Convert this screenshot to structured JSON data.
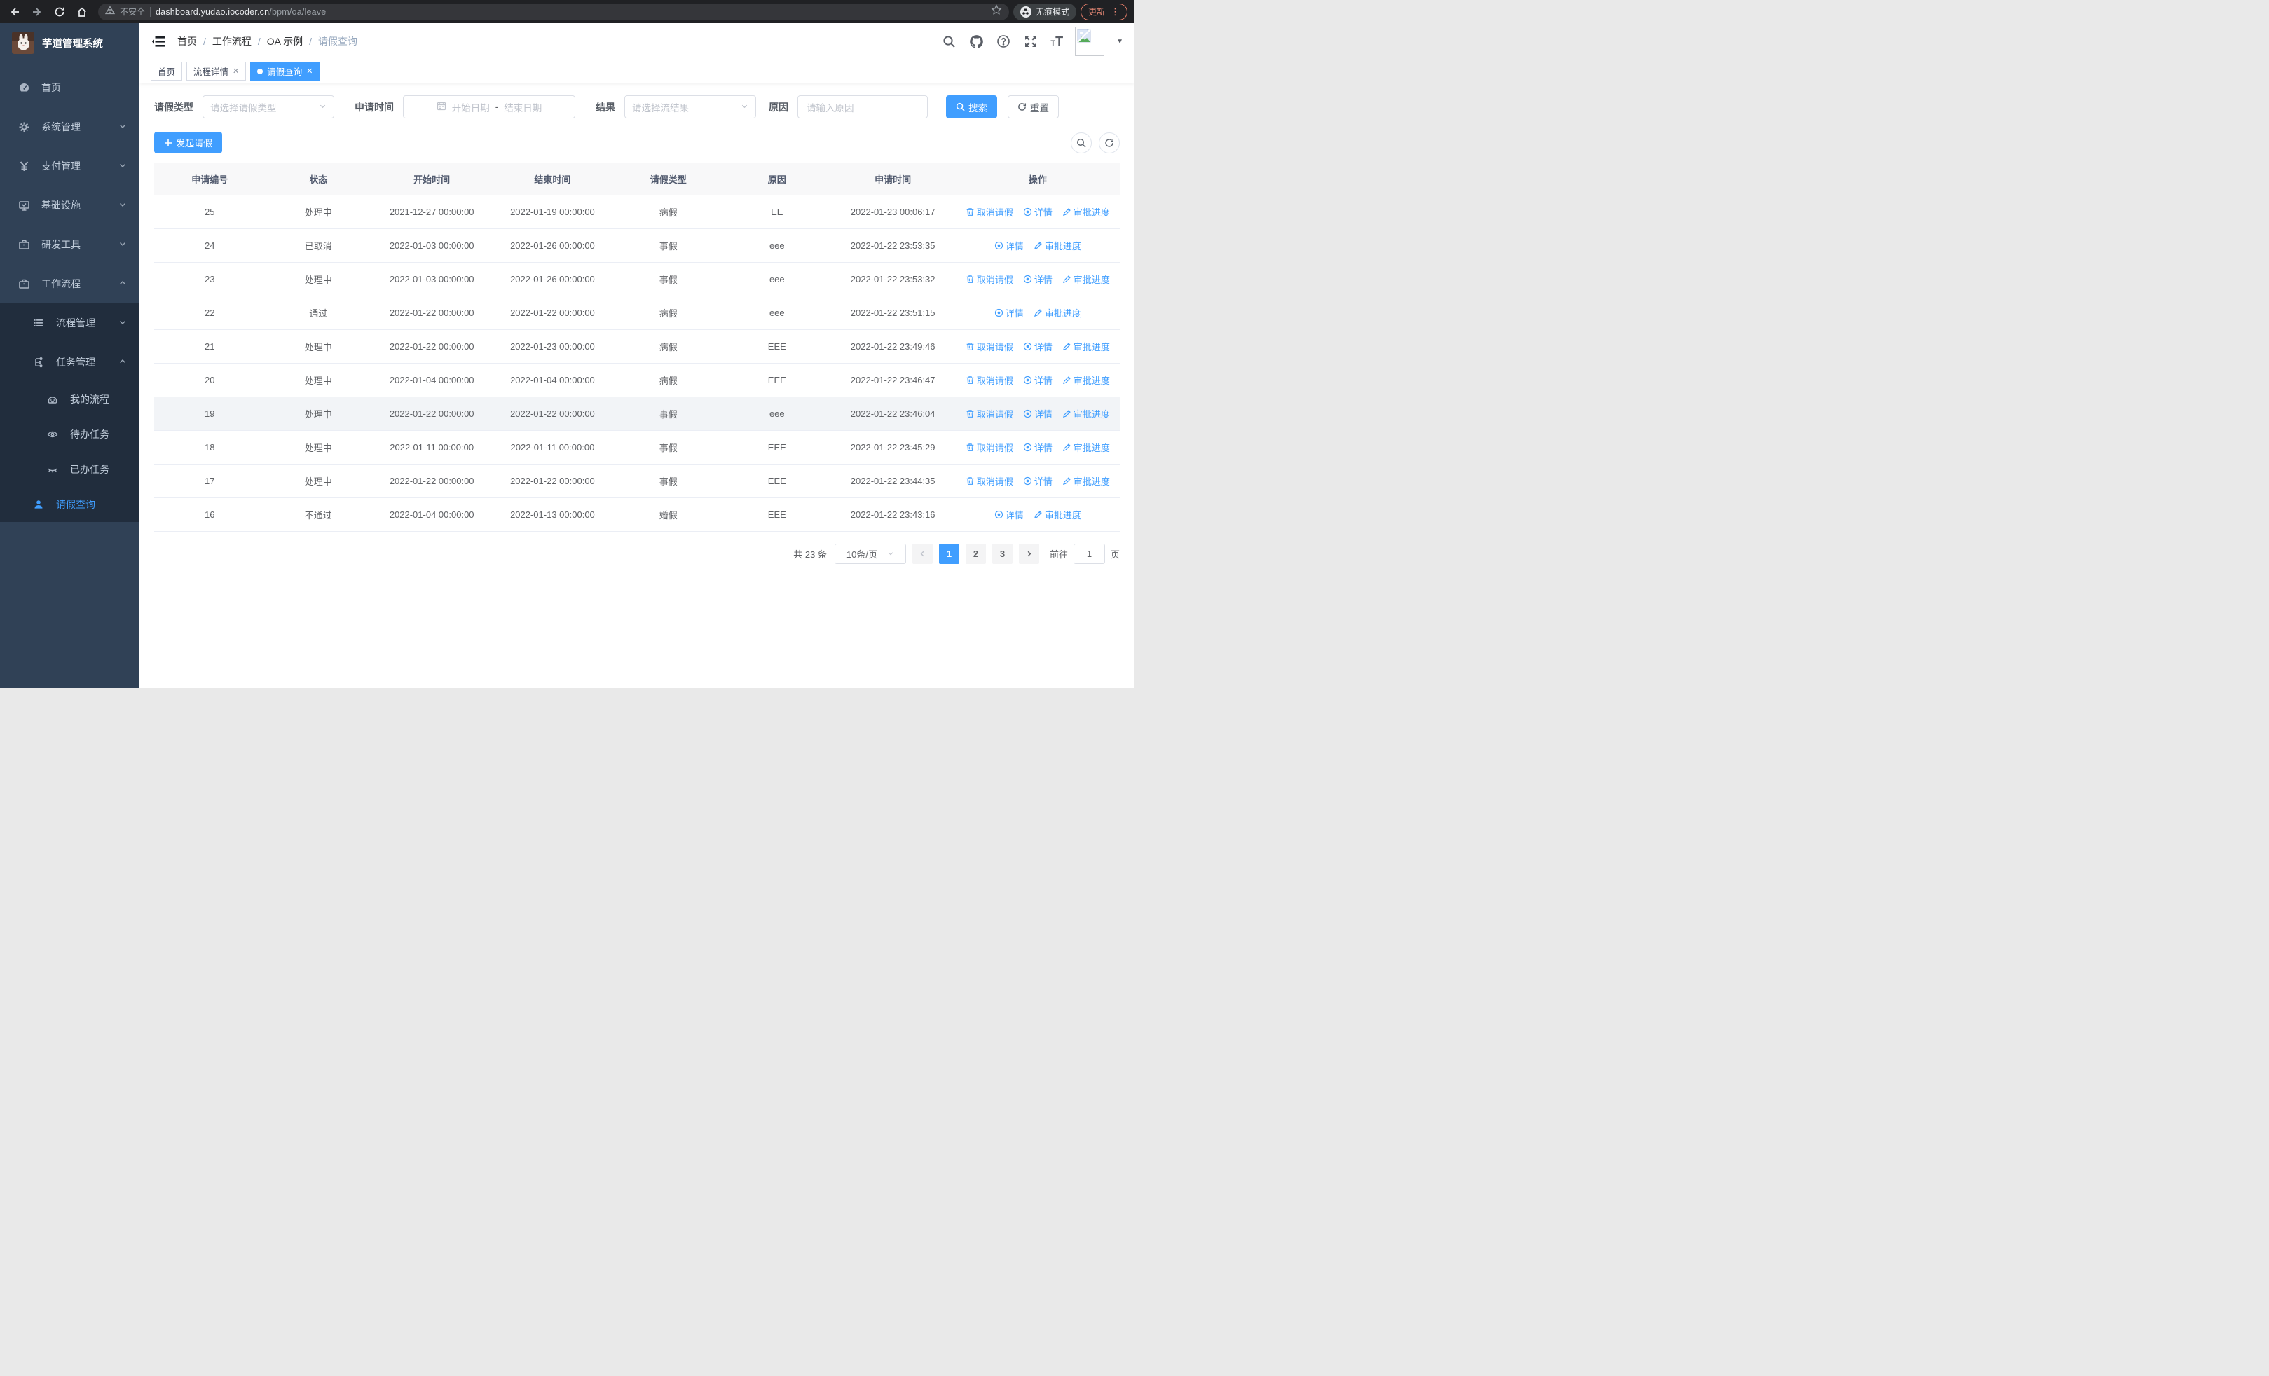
{
  "colors": {
    "primary": "#409EFF",
    "sidebar_bg": "#304156",
    "submenu_bg": "#212d3d",
    "chrome_bg": "#202124",
    "update_accent": "#E07B67",
    "table_header_bg": "#F8F8F9"
  },
  "browser": {
    "security_label": "不安全",
    "url_domain": "dashboard.yudao.iocoder.cn",
    "url_path": "/bpm/oa/leave",
    "incognito_label": "无痕模式",
    "update_label": "更新"
  },
  "sidebar": {
    "title": "芋道管理系统",
    "menu": [
      {
        "label": "首页"
      },
      {
        "label": "系统管理"
      },
      {
        "label": "支付管理"
      },
      {
        "label": "基础设施"
      },
      {
        "label": "研发工具"
      },
      {
        "label": "工作流程"
      }
    ],
    "submenu": [
      {
        "label": "流程管理"
      },
      {
        "label": "任务管理"
      },
      {
        "label": "我的流程"
      },
      {
        "label": "待办任务"
      },
      {
        "label": "已办任务"
      },
      {
        "label": "请假查询"
      }
    ]
  },
  "header": {
    "breadcrumb": [
      "首页",
      "工作流程",
      "OA 示例",
      "请假查询"
    ],
    "tabs": [
      {
        "label": "首页"
      },
      {
        "label": "流程详情"
      },
      {
        "label": "请假查询"
      }
    ]
  },
  "filters": {
    "leave_type_label": "请假类型",
    "leave_type_placeholder": "请选择请假类型",
    "apply_time_label": "申请时间",
    "date_start_placeholder": "开始日期",
    "date_separator": "-",
    "date_end_placeholder": "结束日期",
    "result_label": "结果",
    "result_placeholder": "请选择流结果",
    "reason_label": "原因",
    "reason_placeholder": "请输入原因",
    "search_label": "搜索",
    "reset_label": "重置"
  },
  "toolbar": {
    "create_label": "发起请假"
  },
  "table": {
    "columns": [
      "申请编号",
      "状态",
      "开始时间",
      "结束时间",
      "请假类型",
      "原因",
      "申请时间",
      "操作"
    ],
    "action_labels": {
      "cancel": "取消请假",
      "detail": "详情",
      "progress": "审批进度"
    },
    "rows": [
      {
        "id": "25",
        "status": "处理中",
        "start": "2021-12-27 00:00:00",
        "end": "2022-01-19 00:00:00",
        "type": "病假",
        "reason": "EE",
        "apply_time": "2022-01-23 00:06:17",
        "actions": [
          "cancel",
          "detail",
          "progress"
        ]
      },
      {
        "id": "24",
        "status": "已取消",
        "start": "2022-01-03 00:00:00",
        "end": "2022-01-26 00:00:00",
        "type": "事假",
        "reason": "eee",
        "apply_time": "2022-01-22 23:53:35",
        "actions": [
          "detail",
          "progress"
        ]
      },
      {
        "id": "23",
        "status": "处理中",
        "start": "2022-01-03 00:00:00",
        "end": "2022-01-26 00:00:00",
        "type": "事假",
        "reason": "eee",
        "apply_time": "2022-01-22 23:53:32",
        "actions": [
          "cancel",
          "detail",
          "progress"
        ]
      },
      {
        "id": "22",
        "status": "通过",
        "start": "2022-01-22 00:00:00",
        "end": "2022-01-22 00:00:00",
        "type": "病假",
        "reason": "eee",
        "apply_time": "2022-01-22 23:51:15",
        "actions": [
          "detail",
          "progress"
        ]
      },
      {
        "id": "21",
        "status": "处理中",
        "start": "2022-01-22 00:00:00",
        "end": "2022-01-23 00:00:00",
        "type": "病假",
        "reason": "EEE",
        "apply_time": "2022-01-22 23:49:46",
        "actions": [
          "cancel",
          "detail",
          "progress"
        ]
      },
      {
        "id": "20",
        "status": "处理中",
        "start": "2022-01-04 00:00:00",
        "end": "2022-01-04 00:00:00",
        "type": "病假",
        "reason": "EEE",
        "apply_time": "2022-01-22 23:46:47",
        "actions": [
          "cancel",
          "detail",
          "progress"
        ]
      },
      {
        "id": "19",
        "status": "处理中",
        "start": "2022-01-22 00:00:00",
        "end": "2022-01-22 00:00:00",
        "type": "事假",
        "reason": "eee",
        "apply_time": "2022-01-22 23:46:04",
        "actions": [
          "cancel",
          "detail",
          "progress"
        ],
        "highlighted": true
      },
      {
        "id": "18",
        "status": "处理中",
        "start": "2022-01-11 00:00:00",
        "end": "2022-01-11 00:00:00",
        "type": "事假",
        "reason": "EEE",
        "apply_time": "2022-01-22 23:45:29",
        "actions": [
          "cancel",
          "detail",
          "progress"
        ]
      },
      {
        "id": "17",
        "status": "处理中",
        "start": "2022-01-22 00:00:00",
        "end": "2022-01-22 00:00:00",
        "type": "事假",
        "reason": "EEE",
        "apply_time": "2022-01-22 23:44:35",
        "actions": [
          "cancel",
          "detail",
          "progress"
        ]
      },
      {
        "id": "16",
        "status": "不通过",
        "start": "2022-01-04 00:00:00",
        "end": "2022-01-13 00:00:00",
        "type": "婚假",
        "reason": "EEE",
        "apply_time": "2022-01-22 23:43:16",
        "actions": [
          "detail",
          "progress"
        ]
      }
    ]
  },
  "pagination": {
    "total_label": "共 23 条",
    "page_size": "10条/页",
    "pages": [
      "1",
      "2",
      "3"
    ],
    "active_page": "1",
    "goto_label": "前往",
    "goto_value": "1",
    "goto_suffix": "页"
  }
}
